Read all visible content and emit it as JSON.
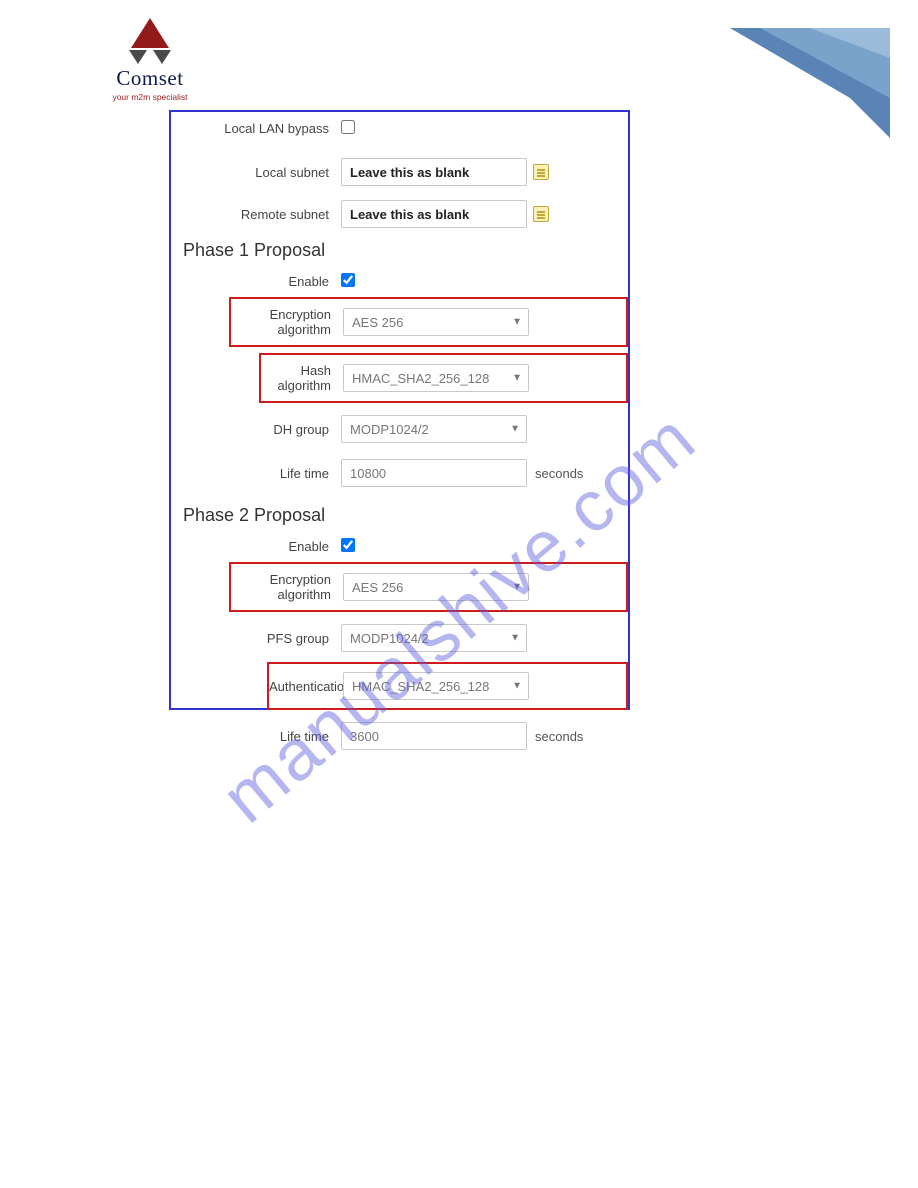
{
  "brand": {
    "name": "Comset",
    "tagline": "your m2m specialist"
  },
  "watermark": "manualshive.com",
  "top": {
    "lanBypass": {
      "label": "Local LAN bypass",
      "checked": false
    },
    "localSubnet": {
      "label": "Local subnet",
      "value": "Leave this as blank"
    },
    "remoteSubnet": {
      "label": "Remote subnet",
      "value": "Leave this as blank"
    }
  },
  "phase1": {
    "title": "Phase 1 Proposal",
    "enable": {
      "label": "Enable",
      "checked": true
    },
    "encAlgo": {
      "label": "Encryption algorithm",
      "value": "AES 256"
    },
    "hashAlgo": {
      "label": "Hash algorithm",
      "value": "HMAC_SHA2_256_128"
    },
    "dhGroup": {
      "label": "DH group",
      "value": "MODP1024/2"
    },
    "lifetime": {
      "label": "Life time",
      "value": "10800",
      "unit": "seconds"
    }
  },
  "phase2": {
    "title": "Phase 2 Proposal",
    "enable": {
      "label": "Enable",
      "checked": true
    },
    "encAlgo": {
      "label": "Encryption algorithm",
      "value": "AES 256"
    },
    "pfsGroup": {
      "label": "PFS group",
      "value": "MODP1024/2"
    },
    "auth": {
      "label": "Authentication",
      "value": "HMAC_SHA2_256_128"
    },
    "lifetime": {
      "label": "Life time",
      "value": "3600",
      "unit": "seconds"
    }
  }
}
